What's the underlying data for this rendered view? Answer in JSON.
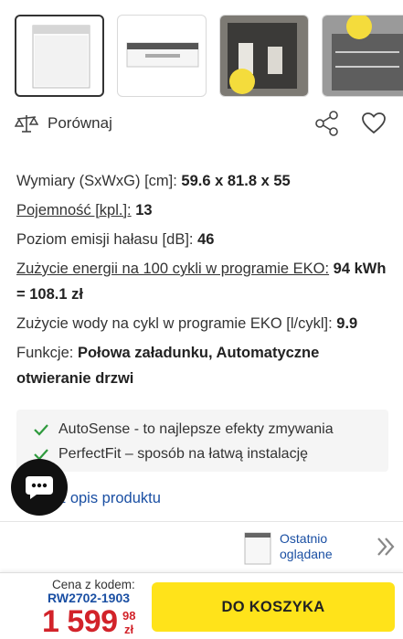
{
  "actions": {
    "compare_label": "Porównaj"
  },
  "specs": [
    {
      "label": "Wymiary (SxWxG) [cm]:",
      "value": "59.6 x 81.8 x 55",
      "underlined": false
    },
    {
      "label": "Pojemność [kpl.]:",
      "value": "13",
      "underlined": true
    },
    {
      "label": "Poziom emisji hałasu [dB]:",
      "value": "46",
      "underlined": false
    },
    {
      "label": "Zużycie energii na 100 cykli w programie EKO:",
      "value": "94 kWh = 108.1 zł",
      "underlined": true
    },
    {
      "label": "Zużycie wody na cykl w programie EKO [l/cykl]:",
      "value": "9.9",
      "underlined": false
    },
    {
      "label": "Funkcje:",
      "value": "Połowa załadunku, Automatyczne otwieranie drzwi",
      "underlined": false
    }
  ],
  "features": [
    {
      "text": "AutoSense - to najlepsze efekty zmywania"
    },
    {
      "text": "PerfectFit – sposób na łatwą instalację"
    }
  ],
  "description_link": "z opis produktu",
  "recent": {
    "label": "Ostatnio oglądane"
  },
  "cart": {
    "code_label": "Cena z kodem:",
    "code": "RW2702-1903",
    "price_main": "1 599",
    "price_cents": "98",
    "currency": "zł",
    "button_label": "DO KOSZYKA"
  },
  "colors": {
    "accent_yellow": "#ffe31a",
    "price_red": "#d2232a",
    "link_blue": "#1a4fa3",
    "check_green": "#2e9a3d"
  }
}
